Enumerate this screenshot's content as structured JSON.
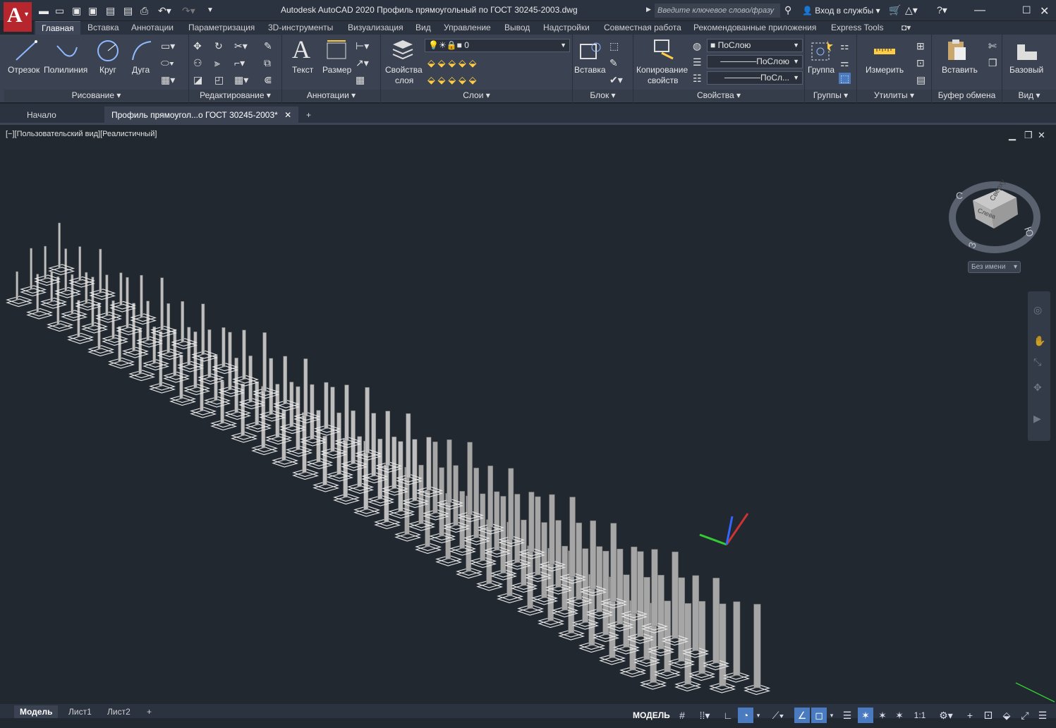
{
  "app": {
    "title": "Autodesk AutoCAD 2020   Профиль прямоугольный по ГОСТ 30245-2003.dwg",
    "search_placeholder": "Введите ключевое слово/фразу",
    "signin": "Вход в службы",
    "accent": "#b8262d"
  },
  "ribbon_tabs": [
    "Главная",
    "Вставка",
    "Аннотации",
    "Параметризация",
    "3D-инструменты",
    "Визуализация",
    "Вид",
    "Управление",
    "Вывод",
    "Надстройки",
    "Совместная работа",
    "Рекомендованные приложения",
    "Express Tools"
  ],
  "panels": {
    "draw": {
      "title": "Рисование",
      "line": "Отрезок",
      "polyline": "Полилиния",
      "circle": "Круг",
      "arc": "Дуга"
    },
    "modify": {
      "title": "Редактирование"
    },
    "annotation": {
      "title": "Аннотации",
      "text": "Текст",
      "dimension": "Размер"
    },
    "layers": {
      "title": "Слои",
      "props_line1": "Свойства",
      "props_line2": "слоя",
      "current_layer": "0"
    },
    "block": {
      "title": "Блок",
      "insert": "Вставка"
    },
    "properties": {
      "title": "Свойства",
      "match_line1": "Копирование",
      "match_line2": "свойств",
      "color": "ПоСлою",
      "linetype": "ПоСлою",
      "lineweight": "ПоСл..."
    },
    "groups": {
      "title": "Группы",
      "group": "Группа"
    },
    "utilities": {
      "title": "Утилиты",
      "measure": "Измерить"
    },
    "clipboard": {
      "title": "Буфер обмена",
      "paste": "Вставить"
    },
    "view": {
      "title": "Вид",
      "base": "Базовый"
    }
  },
  "doc_tabs": {
    "start": "Начало",
    "file": "Профиль прямоугол...о ГОСТ 30245-2003*"
  },
  "viewport": {
    "label": "[−][Пользовательский вид][Реалистичный]",
    "viewcube_top": "Сверху",
    "viewcube_left": "Слева",
    "compass": {
      "n": "С",
      "s": "Ю",
      "w": "З"
    },
    "named_view": "Без имени"
  },
  "layout_tabs": [
    "Модель",
    "Лист1",
    "Лист2"
  ],
  "status": {
    "model": "МОДЕЛЬ",
    "scale": "1:1"
  }
}
